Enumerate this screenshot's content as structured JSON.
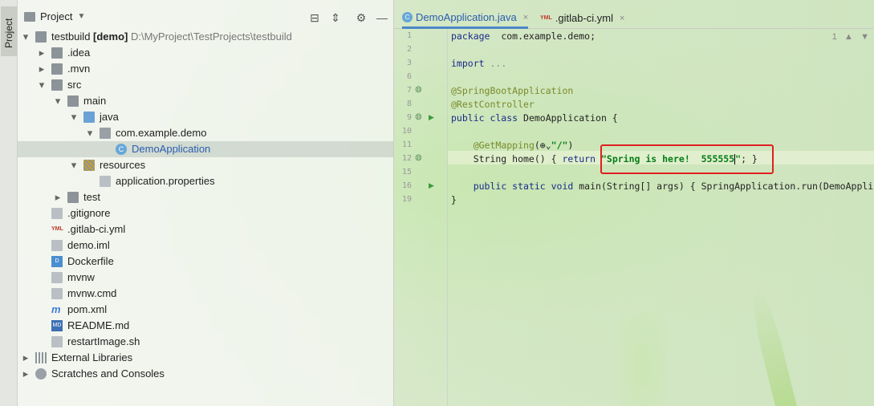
{
  "sidebar": {
    "tab_label": "Project"
  },
  "project_panel": {
    "title": "Project",
    "toolbar": [
      "align-icon",
      "collapse-icon",
      "gear-icon",
      "minimize-icon"
    ]
  },
  "tree": [
    {
      "label": "testbuild",
      "bold": "[demo]",
      "path": "D:\\MyProject\\TestProjects\\testbuild",
      "indent": 0,
      "arrow": "down",
      "icon": "folder"
    },
    {
      "label": ".idea",
      "indent": 1,
      "arrow": "right",
      "icon": "folder"
    },
    {
      "label": ".mvn",
      "indent": 1,
      "arrow": "right",
      "icon": "folder"
    },
    {
      "label": "src",
      "indent": 1,
      "arrow": "down",
      "icon": "folder"
    },
    {
      "label": "main",
      "indent": 2,
      "arrow": "down",
      "icon": "folder"
    },
    {
      "label": "java",
      "indent": 3,
      "arrow": "down",
      "icon": "folder-blue"
    },
    {
      "label": "com.example.demo",
      "indent": 4,
      "arrow": "down",
      "icon": "package"
    },
    {
      "label": "DemoApplication",
      "indent": 5,
      "arrow": "",
      "icon": "class",
      "selected": true
    },
    {
      "label": "resources",
      "indent": 3,
      "arrow": "down",
      "icon": "folder-res"
    },
    {
      "label": "application.properties",
      "indent": 4,
      "arrow": "",
      "icon": "properties"
    },
    {
      "label": "test",
      "indent": 2,
      "arrow": "right",
      "icon": "folder"
    },
    {
      "label": ".gitignore",
      "indent": 1,
      "arrow": "",
      "icon": "file"
    },
    {
      "label": ".gitlab-ci.yml",
      "indent": 1,
      "arrow": "",
      "icon": "yml"
    },
    {
      "label": "demo.iml",
      "indent": 1,
      "arrow": "",
      "icon": "file"
    },
    {
      "label": "Dockerfile",
      "indent": 1,
      "arrow": "",
      "icon": "docker"
    },
    {
      "label": "mvnw",
      "indent": 1,
      "arrow": "",
      "icon": "file"
    },
    {
      "label": "mvnw.cmd",
      "indent": 1,
      "arrow": "",
      "icon": "file"
    },
    {
      "label": "pom.xml",
      "indent": 1,
      "arrow": "",
      "icon": "maven"
    },
    {
      "label": "README.md",
      "indent": 1,
      "arrow": "",
      "icon": "md"
    },
    {
      "label": "restartImage.sh",
      "indent": 1,
      "arrow": "",
      "icon": "file"
    },
    {
      "label": "External Libraries",
      "indent": 0,
      "arrow": "right",
      "icon": "library"
    },
    {
      "label": "Scratches and Consoles",
      "indent": 0,
      "arrow": "right",
      "icon": "scratch"
    }
  ],
  "icon_glyphs": {
    "class": "C",
    "yml": "YML",
    "md": "MD",
    "docker": "D",
    "maven": "m"
  },
  "tabs": [
    {
      "label": "DemoApplication.java",
      "active": true,
      "close": "×"
    },
    {
      "label": ".gitlab-ci.yml",
      "active": false,
      "close": "×"
    }
  ],
  "editor_tools": {
    "count": "1",
    "up": "▲",
    "down": "▼"
  },
  "code_lines": [
    {
      "num": "1",
      "html": [
        [
          "kw",
          "package"
        ],
        [
          "",
          "  com.example.demo;"
        ]
      ]
    },
    {
      "num": "2",
      "html": []
    },
    {
      "num": "3",
      "html": [
        [
          "kw",
          "import"
        ],
        [
          "fold",
          " ..."
        ]
      ]
    },
    {
      "num": "6",
      "html": []
    },
    {
      "num": "7",
      "html": [
        [
          "ann",
          "@SpringBootApplication"
        ]
      ]
    },
    {
      "num": "8",
      "html": [
        [
          "ann",
          "@RestController"
        ]
      ]
    },
    {
      "num": "9",
      "html": [
        [
          "kw",
          "public class"
        ],
        [
          "",
          " DemoApplication {"
        ]
      ]
    },
    {
      "num": "10",
      "html": []
    },
    {
      "num": "11",
      "html": [
        [
          "",
          "    "
        ],
        [
          "ann",
          "@GetMapping"
        ],
        [
          "",
          "(⊕⌄"
        ],
        [
          "str",
          "\"/\""
        ],
        [
          "",
          ")"
        ]
      ]
    },
    {
      "num": "12",
      "html": [
        [
          "",
          "    String home() { "
        ],
        [
          "kw",
          "return"
        ],
        [
          "",
          " "
        ],
        [
          "str",
          "\"Spring is here!  555555"
        ],
        [
          "caret",
          ""
        ],
        [
          "str",
          "\""
        ],
        [
          "",
          "; }"
        ]
      ]
    },
    {
      "num": "15",
      "html": []
    },
    {
      "num": "16",
      "html": [
        [
          "",
          "    "
        ],
        [
          "kw",
          "public static void"
        ],
        [
          "",
          " main(String[] args) { SpringApplication."
        ],
        [
          "",
          "run"
        ],
        [
          "",
          "(DemoAppli"
        ]
      ]
    },
    {
      "num": "19",
      "html": [
        [
          "",
          "}"
        ]
      ]
    }
  ],
  "gutter_icons": {
    "bean": "◍",
    "run": "▶"
  }
}
